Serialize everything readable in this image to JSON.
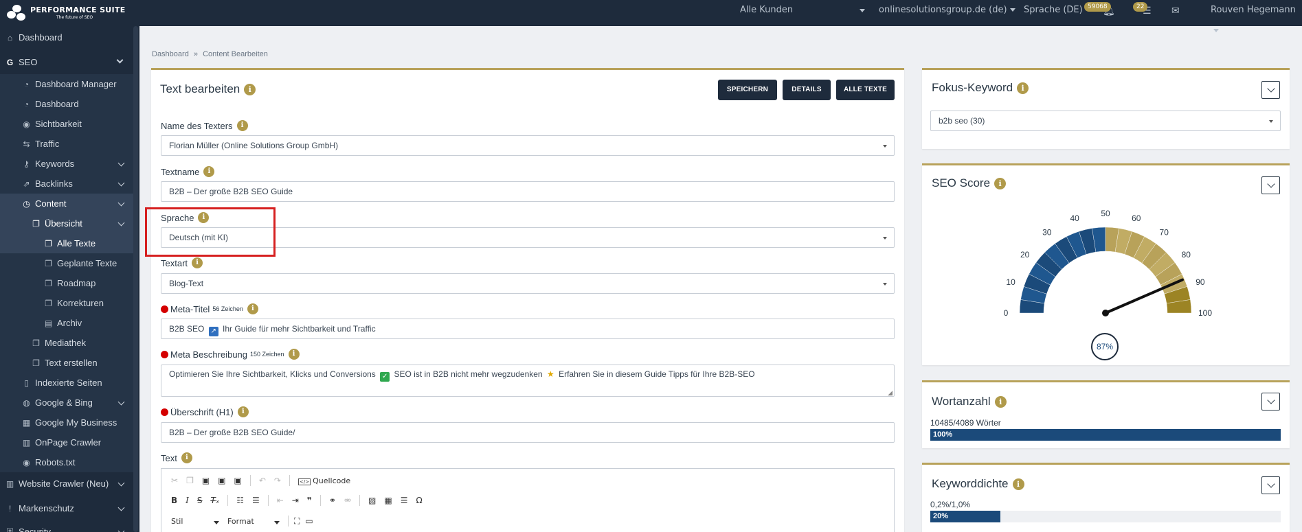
{
  "topbar": {
    "brand": "Performance Suite",
    "tagline": "The future of SEO",
    "customer_select": "Alle Kunden",
    "domain_select": "onlinesolutionsgroup.de (de)",
    "language_select": "Sprache (DE)",
    "notifications_count": "59068",
    "tasks_count": "22",
    "user_name": "Rouven Hegemann"
  },
  "sidebar": {
    "dashboard": "Dashboard",
    "seo": "SEO",
    "dashboard_manager": "Dashboard Manager",
    "seo_dashboard": "Dashboard",
    "sichtbarkeit": "Sichtbarkeit",
    "traffic": "Traffic",
    "keywords": "Keywords",
    "backlinks": "Backlinks",
    "content": "Content",
    "uebersicht": "Übersicht",
    "alle_texte": "Alle Texte",
    "geplante_texte": "Geplante Texte",
    "roadmap": "Roadmap",
    "korrekturen": "Korrekturen",
    "archiv": "Archiv",
    "mediathek": "Mediathek",
    "text_erstellen": "Text erstellen",
    "indexierte_seiten": "Indexierte Seiten",
    "google_bing": "Google & Bing",
    "google_my_business": "Google My Business",
    "onpage_crawler": "OnPage Crawler",
    "robots": "Robots.txt",
    "website_crawler": "Website Crawler (Neu)",
    "markenschutz": "Markenschutz",
    "security": "Security"
  },
  "breadcrumb": {
    "home": "Dashboard",
    "separator": "»",
    "current": "Content Bearbeiten"
  },
  "editor_panel": {
    "title": "Text bearbeiten",
    "save_label": "SPEICHERN",
    "details_label": "DETAILS",
    "all_texts_label": "ALLE TEXTE",
    "writer_label": "Name des Texters",
    "writer_value": "Florian Müller (Online Solutions Group GmbH)",
    "textname_label": "Textname",
    "textname_value": "B2B – Der große B2B SEO Guide",
    "language_label": "Sprache",
    "language_value": "Deutsch (mit KI)",
    "texttype_label": "Textart",
    "texttype_value": "Blog-Text",
    "meta_title_label": "Meta-Titel",
    "meta_title_count": "56 Zeichen",
    "meta_title_value_a": "B2B SEO",
    "meta_title_value_b": "Ihr Guide für mehr Sichtbarkeit und Traffic",
    "meta_desc_label": "Meta Beschreibung",
    "meta_desc_count": "150 Zeichen",
    "meta_desc_value_a": "Optimieren Sie Ihre Sichtbarkeit, Klicks und Conversions",
    "meta_desc_value_b": "SEO ist in B2B nicht mehr wegzudenken",
    "meta_desc_value_c": "Erfahren Sie in diesem Guide Tipps für Ihre B2B-SEO",
    "h1_label": "Überschrift (H1)",
    "h1_value": "B2B – Der große B2B SEO Guide/",
    "text_label": "Text",
    "source_label": "Quellcode",
    "style_select": "Stil",
    "format_select": "Format"
  },
  "focus_keyword": {
    "title": "Fokus-Keyword",
    "value": "b2b seo (30)"
  },
  "seo_score": {
    "title": "SEO Score",
    "score": 87,
    "score_label": "87%",
    "ticks": [
      "0",
      "10",
      "20",
      "30",
      "40",
      "50",
      "60",
      "70",
      "80",
      "90",
      "100"
    ]
  },
  "word_count": {
    "title": "Wortanzahl",
    "value": "10485/4089 Wörter",
    "percent": 100,
    "percent_label": "100%"
  },
  "keyword_density": {
    "title": "Keyworddichte",
    "value": "0,2%/1,0%",
    "percent": 20,
    "percent_label": "20%"
  },
  "colors": {
    "navy": "#1e2b3c",
    "gold": "#b09a4a",
    "gauge_blue": "#1b4a7a",
    "gauge_gold": "#b8a25a",
    "alert_red": "#d40000"
  }
}
